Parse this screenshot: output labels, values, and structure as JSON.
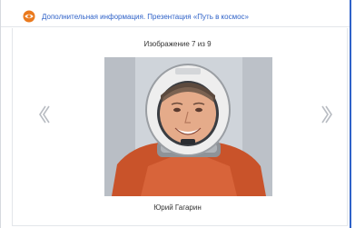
{
  "window": {
    "title": "Дополнительная информация. Презентация «Путь в космос»",
    "icon": "eye-icon",
    "accent_color": "#2f62c8"
  },
  "slideshow": {
    "counter": "Изображение 7 из 9",
    "caption": "Юрий Гагарин",
    "current_index": 7,
    "total": 9,
    "prev_icon": "chevron-left-icon",
    "next_icon": "chevron-right-icon"
  }
}
